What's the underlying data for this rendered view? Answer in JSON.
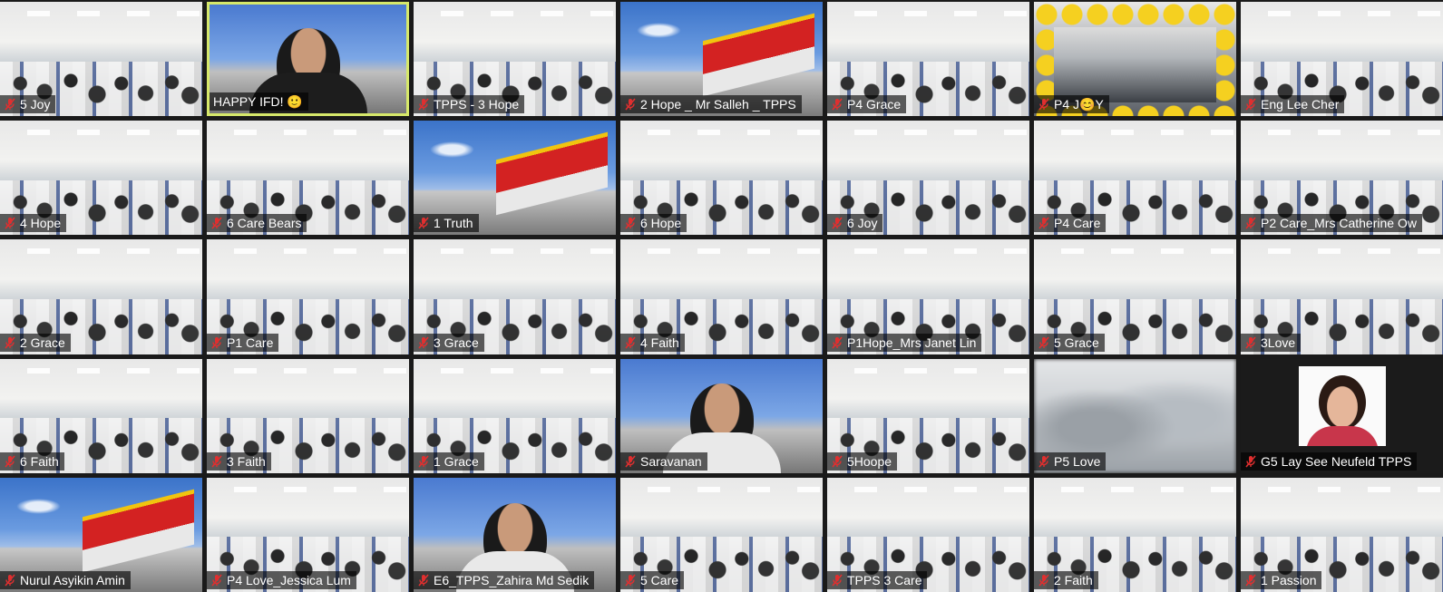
{
  "colors": {
    "muted_icon": "#e02f2f",
    "active_speaker_border": "#d6e86a",
    "background": "#1a1a1a"
  },
  "participants": [
    {
      "name": "5 Joy",
      "scene": "classroom",
      "muted": true
    },
    {
      "name": "HAPPY IFD! 🙂",
      "scene": "person",
      "muted": false,
      "active": true
    },
    {
      "name": "TPPS - 3 Hope",
      "scene": "classroom",
      "muted": true
    },
    {
      "name": "2 Hope _ Mr Salleh _ TPPS",
      "scene": "building",
      "muted": true
    },
    {
      "name": "P4 Grace",
      "scene": "classroom",
      "muted": true
    },
    {
      "name": "P4 J😊Y",
      "scene": "emoji",
      "muted": true
    },
    {
      "name": "Eng Lee Cher",
      "scene": "classroom",
      "muted": true
    },
    {
      "name": "4 Hope",
      "scene": "classroom",
      "muted": true
    },
    {
      "name": "6 Care Bears",
      "scene": "classroom",
      "muted": true
    },
    {
      "name": "1 Truth",
      "scene": "building",
      "muted": true
    },
    {
      "name": "6 Hope",
      "scene": "classroom",
      "muted": true
    },
    {
      "name": "6 Joy",
      "scene": "classroom",
      "muted": true
    },
    {
      "name": "P4 Care",
      "scene": "classroom",
      "muted": true
    },
    {
      "name": "P2 Care_Mrs Catherine Ow",
      "scene": "classroom",
      "muted": true
    },
    {
      "name": "2 Grace",
      "scene": "classroom",
      "muted": true
    },
    {
      "name": "P1 Care",
      "scene": "classroom",
      "muted": true
    },
    {
      "name": "3 Grace",
      "scene": "classroom",
      "muted": true
    },
    {
      "name": "4 Faith",
      "scene": "classroom",
      "muted": true
    },
    {
      "name": "P1Hope_Mrs Janet Lin",
      "scene": "classroom",
      "muted": true
    },
    {
      "name": "5 Grace",
      "scene": "classroom",
      "muted": true
    },
    {
      "name": "3Love",
      "scene": "classroom",
      "muted": true
    },
    {
      "name": "6 Faith",
      "scene": "classroom",
      "muted": true
    },
    {
      "name": "3 Faith",
      "scene": "classroom",
      "muted": true
    },
    {
      "name": "1 Grace",
      "scene": "classroom",
      "muted": true
    },
    {
      "name": "Saravanan",
      "scene": "person-building",
      "muted": true
    },
    {
      "name": "5Hoope",
      "scene": "classroom",
      "muted": true
    },
    {
      "name": "P5 Love",
      "scene": "blurred",
      "muted": true
    },
    {
      "name": "G5 Lay See Neufeld TPPS",
      "scene": "dark-photo",
      "muted": true
    },
    {
      "name": "Nurul Asyikin Amin",
      "scene": "building",
      "muted": true
    },
    {
      "name": "P4 Love_Jessica Lum",
      "scene": "classroom",
      "muted": true
    },
    {
      "name": "E6_TPPS_Zahira Md Sedik",
      "scene": "person-building",
      "muted": true
    },
    {
      "name": "5 Care",
      "scene": "classroom",
      "muted": true
    },
    {
      "name": "TPPS 3 Care",
      "scene": "classroom",
      "muted": true
    },
    {
      "name": "2 Faith",
      "scene": "classroom",
      "muted": true
    },
    {
      "name": "1 Passion",
      "scene": "classroom",
      "muted": true
    }
  ]
}
